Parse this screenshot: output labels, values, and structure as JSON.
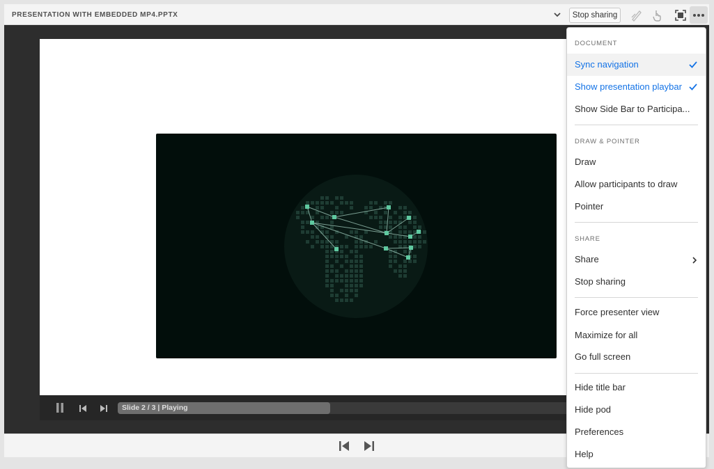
{
  "titlebar": {
    "title": "PRESENTATION WITH EMBEDDED MP4.PPTX",
    "stop_sharing_label": "Stop sharing",
    "icons": [
      "chevron-down-icon",
      "draw-pencil-icon",
      "pointer-hand-icon",
      "fit-screen-icon",
      "more-options-icon"
    ]
  },
  "playbar": {
    "status": "Slide 2 / 3 | Playing",
    "progress": 0.47,
    "icons": [
      "pause-icon",
      "previous-icon",
      "next-icon"
    ]
  },
  "bottombar": {
    "icons": [
      "previous-slide-icon",
      "next-slide-icon"
    ]
  },
  "menu": {
    "sections": [
      {
        "header": "DOCUMENT",
        "items": [
          {
            "label": "Sync navigation",
            "checked": true
          },
          {
            "label": "Show presentation playbar",
            "checked": true
          },
          {
            "label": "Show Side Bar to Participa..."
          }
        ]
      },
      {
        "header": "DRAW & POINTER",
        "items": [
          {
            "label": "Draw"
          },
          {
            "label": "Allow participants to draw"
          },
          {
            "label": "Pointer"
          }
        ]
      },
      {
        "header": "SHARE",
        "items": [
          {
            "label": "Share",
            "submenu": true
          },
          {
            "label": "Stop sharing"
          }
        ]
      },
      {
        "header": "",
        "items": [
          {
            "label": "Force presenter view"
          },
          {
            "label": "Maximize for all"
          },
          {
            "label": "Go full screen"
          }
        ]
      },
      {
        "header": "",
        "items": [
          {
            "label": "Hide title bar"
          },
          {
            "label": "Hide pod"
          },
          {
            "label": "Preferences"
          },
          {
            "label": "Help"
          }
        ]
      }
    ]
  },
  "colors": {
    "accent": "#1473e6",
    "video_bg": "#020e0b",
    "network_node": "#5fc9a0"
  }
}
